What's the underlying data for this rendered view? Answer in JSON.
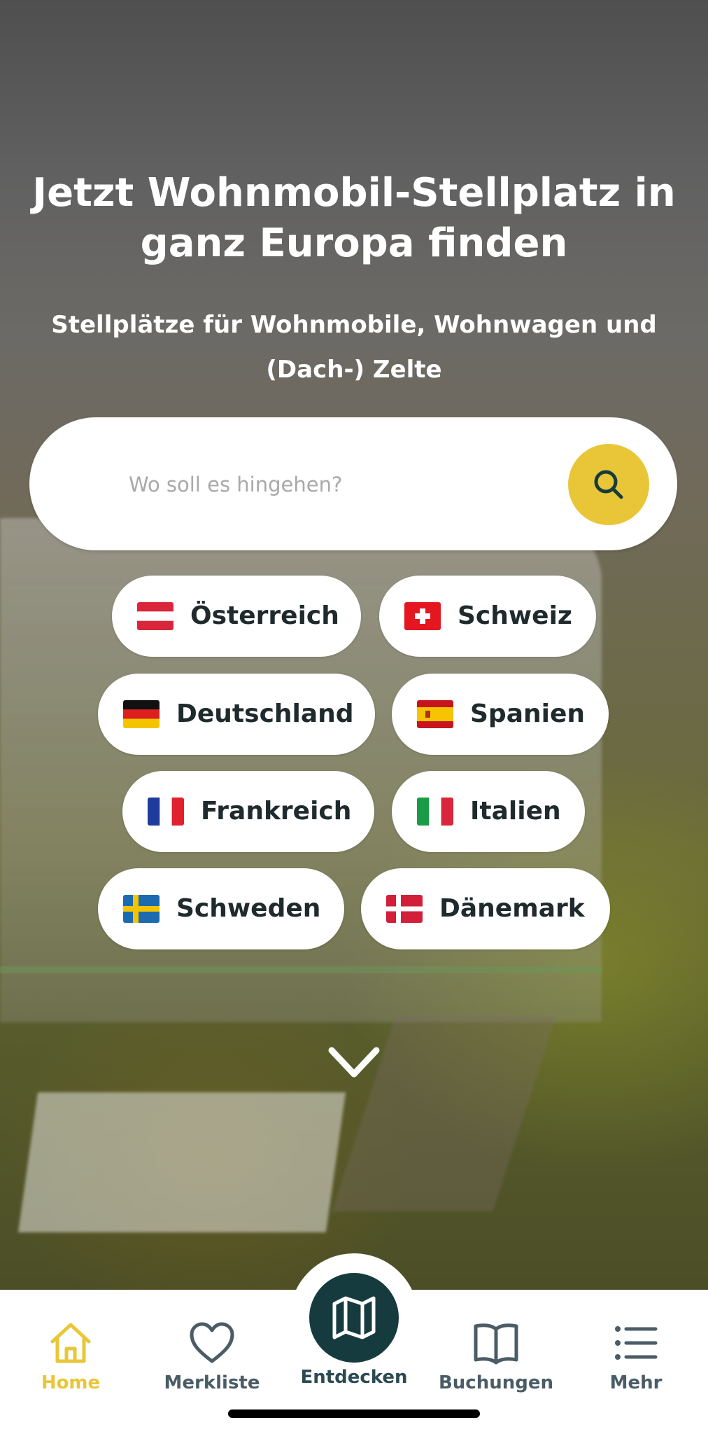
{
  "hero": {
    "title_line1": "Jetzt Wohnmobil-Stellplatz in",
    "title_line2": "ganz Europa finden",
    "subtitle_line1": "Stellplätze für Wohnmobile, Wohnwagen und",
    "subtitle_line2": "(Dach-) Zelte"
  },
  "search": {
    "placeholder": "Wo soll es hingehen?",
    "button_icon": "search-icon",
    "accent_color": "#e9c638"
  },
  "countries": [
    {
      "label": "Österreich",
      "flag": "austria-flag-icon"
    },
    {
      "label": "Schweiz",
      "flag": "switzerland-flag-icon"
    },
    {
      "label": "Deutschland",
      "flag": "germany-flag-icon"
    },
    {
      "label": "Spanien",
      "flag": "spain-flag-icon"
    },
    {
      "label": "Frankreich",
      "flag": "france-flag-icon"
    },
    {
      "label": "Italien",
      "flag": "italy-flag-icon"
    },
    {
      "label": "Schweden",
      "flag": "sweden-flag-icon"
    },
    {
      "label": "Dänemark",
      "flag": "denmark-flag-icon"
    }
  ],
  "scroll_hint_icon": "chevron-down-icon",
  "tabbar": {
    "items": [
      {
        "label": "Home",
        "icon": "home-icon",
        "active": true
      },
      {
        "label": "Merkliste",
        "icon": "heart-icon",
        "active": false
      },
      {
        "label": "Entdecken",
        "icon": "map-icon",
        "active": false
      },
      {
        "label": "Buchungen",
        "icon": "book-icon",
        "active": false
      },
      {
        "label": "Mehr",
        "icon": "menu-list-icon",
        "active": false
      }
    ],
    "active_color": "#e9c638",
    "inactive_color": "#4a5c66",
    "center_button_color": "#163b3f"
  }
}
